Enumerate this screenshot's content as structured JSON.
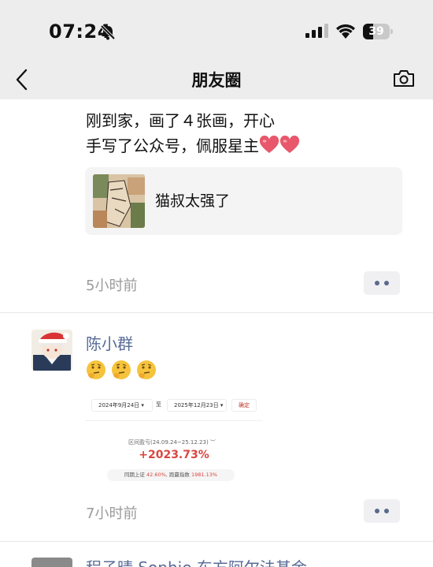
{
  "status_bar": {
    "time": "07:24",
    "battery_level": "39"
  },
  "nav": {
    "title": "朋友圈"
  },
  "post1": {
    "line1": "刚到家，画了４张画，开心",
    "line2": "手写了公众号，佩服星主",
    "link_title": "猫叔太强了",
    "time": "5小时前"
  },
  "post2": {
    "username": "陈小群",
    "emoji": [
      "thinking-face",
      "thinking-face",
      "thinking-face"
    ],
    "image": {
      "start_date": "2024年9月24日",
      "separator": "至",
      "end_date": "2025年12月23日",
      "confirm": "确定",
      "range_label": "区间盈亏(24.09.24~25.12.23)",
      "return_value": "+2023.73%",
      "compare_prefix": "同期上证",
      "compare_a": "42.60%",
      "compare_mid": ", 跑赢指数",
      "compare_b": "1981.13%"
    },
    "time": "7小时前"
  },
  "post3": {
    "username": "程子晴 Sophie 东方阿尔法基金"
  },
  "colors": {
    "name_link": "#576b95",
    "gain_red": "#d9453f",
    "status_bg": "#ededed"
  }
}
